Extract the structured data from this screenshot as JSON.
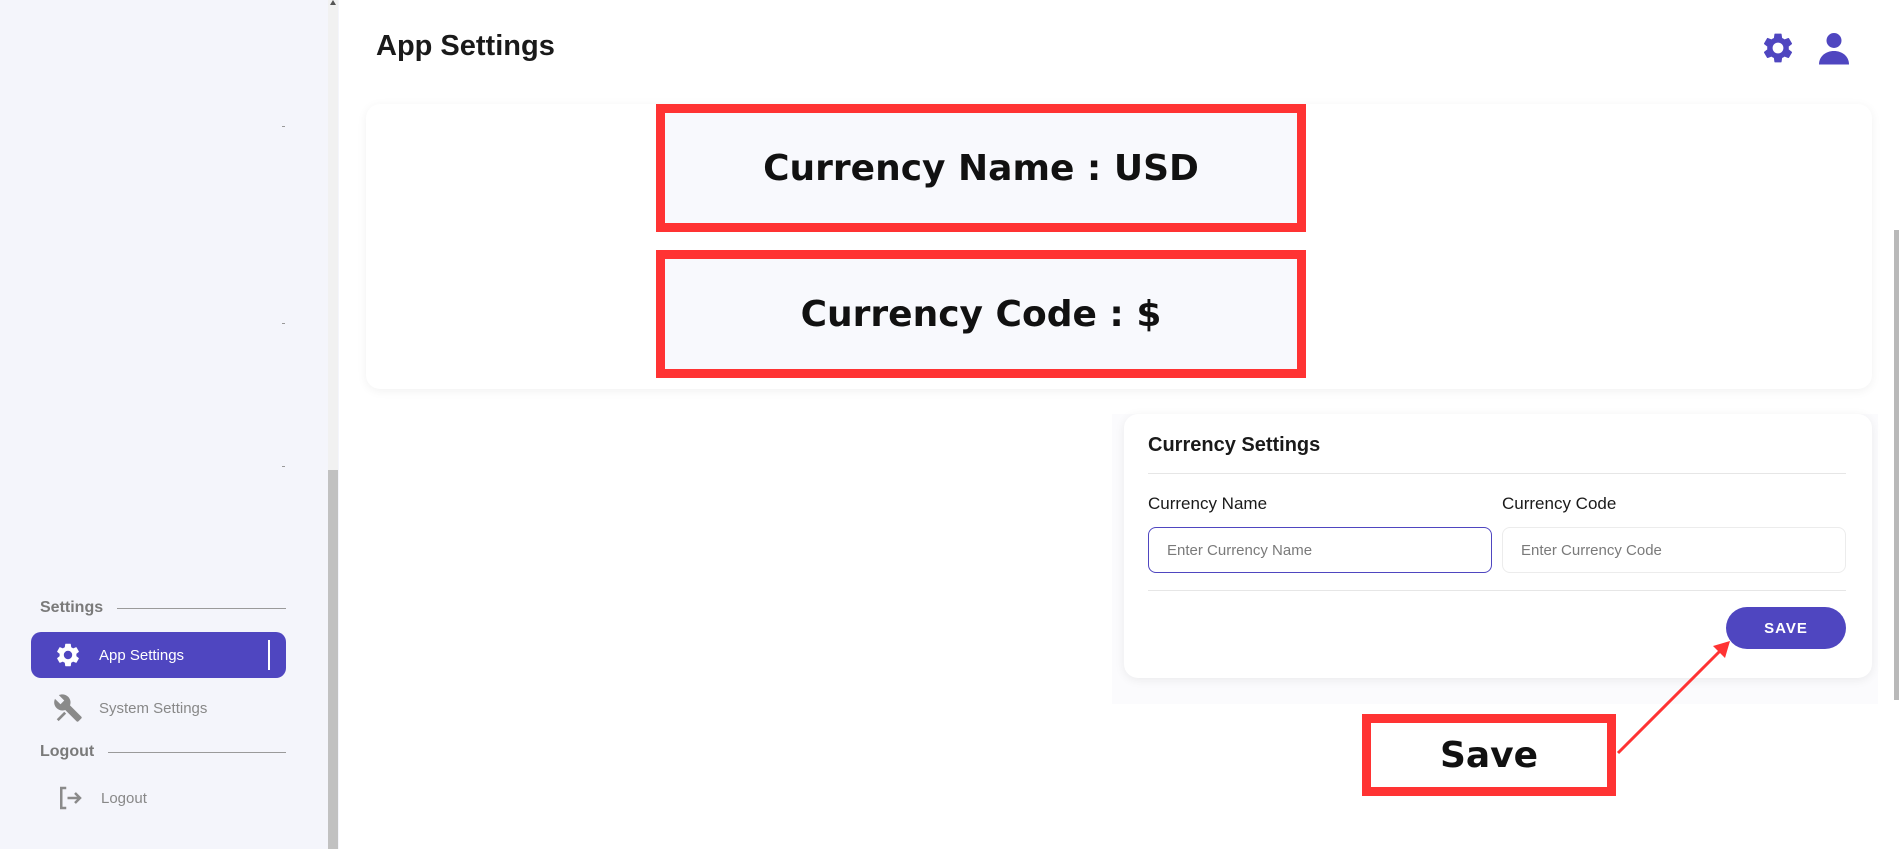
{
  "header": {
    "title": "App Settings",
    "settings_icon": "gear-icon",
    "profile_icon": "user-icon"
  },
  "sidebar": {
    "settings_section": "Settings",
    "items": [
      {
        "label": "App Settings",
        "icon": "gear-icon",
        "active": true
      },
      {
        "label": "System Settings",
        "icon": "tools-icon",
        "active": false
      }
    ],
    "logout_section": "Logout",
    "logout_item": {
      "label": "Logout",
      "icon": "logout-icon"
    }
  },
  "annotations": {
    "currency_name": "Currency Name : USD",
    "currency_code": "Currency Code : $",
    "save": "Save"
  },
  "currency_settings": {
    "title": "Currency Settings",
    "name_label": "Currency Name",
    "name_placeholder": "Enter Currency Name",
    "name_value": "",
    "code_label": "Currency Code",
    "code_placeholder": "Enter Currency Code",
    "code_value": "",
    "save_label": "SAVE"
  },
  "colors": {
    "accent": "#4f46c0",
    "annotation_red": "#ff3333",
    "sidebar_bg": "#f4f5fb"
  }
}
